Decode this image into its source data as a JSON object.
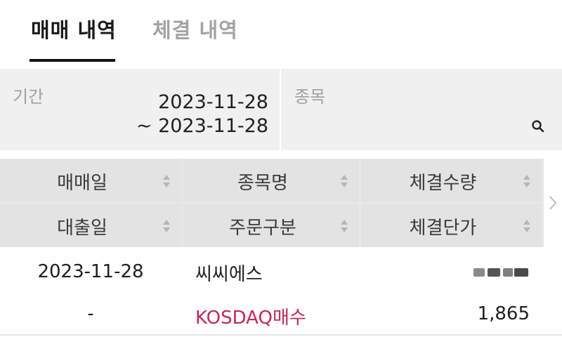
{
  "tabs": [
    {
      "label": "매매 내역",
      "active": true
    },
    {
      "label": "체결 내역",
      "active": false
    }
  ],
  "filter": {
    "period_label": "기간",
    "period_start": "2023-11-28",
    "period_end": "~ 2023-11-28",
    "stock_label": "종목",
    "search_icon": "search-icon"
  },
  "table": {
    "headers": [
      [
        "매매일",
        "종목명",
        "체결수량"
      ],
      [
        "대출일",
        "주문구분",
        "체결단가"
      ]
    ],
    "rows": [
      {
        "trade_date": "2023-11-28",
        "stock_name": "씨씨에스",
        "quantity": "",
        "loan_date": "-",
        "order_type": "KOSDAQ매수",
        "price": "1,865"
      }
    ]
  },
  "colors": {
    "accent": "#c0295c",
    "tab_active": "#1a1a1a",
    "tab_inactive": "#a3a3a3",
    "header_bg": "#e3e3e3",
    "filter_bg": "#f0f0f0"
  }
}
